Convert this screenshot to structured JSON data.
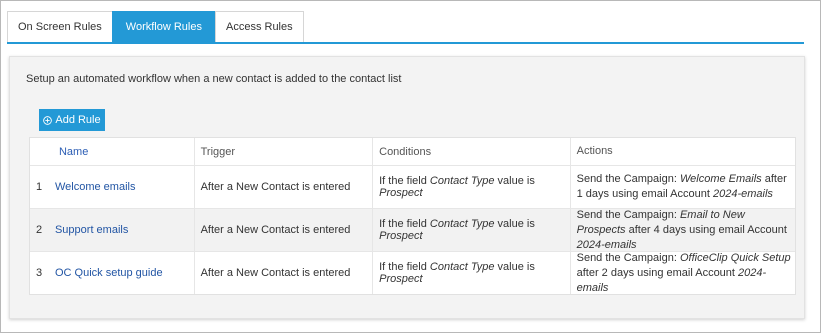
{
  "tabs": [
    {
      "label": "On Screen Rules",
      "active": false
    },
    {
      "label": "Workflow Rules",
      "active": true
    },
    {
      "label": "Access Rules",
      "active": false
    }
  ],
  "panel": {
    "description": "Setup an automated workflow when a new contact is added to the contact list",
    "add_button_label": "Add Rule",
    "add_button_icon": "plus-circle-icon"
  },
  "table": {
    "headers": {
      "name": "Name",
      "trigger": "Trigger",
      "conditions": "Conditions",
      "actions": "Actions"
    },
    "rows": [
      {
        "num": "1",
        "name": "Welcome emails",
        "trigger": "After a New Contact is entered",
        "cond_pre": "If the field ",
        "cond_field": "Contact Type",
        "cond_mid": " value is ",
        "cond_value": "Prospect",
        "act_pre": "Send the Campaign: ",
        "act_campaign": "Welcome Emails",
        "act_mid": " after 1 days using email Account ",
        "act_account": "2024-emails"
      },
      {
        "num": "2",
        "name": "Support emails",
        "trigger": "After a New Contact is entered",
        "cond_pre": "If the field ",
        "cond_field": "Contact Type",
        "cond_mid": " value is ",
        "cond_value": "Prospect",
        "act_pre": "Send the Campaign: ",
        "act_campaign": "Email to New Prospects",
        "act_mid": " after 4 days using email Account ",
        "act_account": "2024-emails"
      },
      {
        "num": "3",
        "name": "OC Quick setup guide",
        "trigger": "After a New Contact is entered",
        "cond_pre": "If the field ",
        "cond_field": "Contact Type",
        "cond_mid": " value is ",
        "cond_value": "Prospect",
        "act_pre": "Send the Campaign: ",
        "act_campaign": "OfficeClip Quick Setup",
        "act_mid": " after 2 days using email Account ",
        "act_account": "2024-emails"
      }
    ]
  },
  "colors": {
    "accent": "#2399d6",
    "link": "#2255a4",
    "panel_bg": "#f3f3f3"
  }
}
